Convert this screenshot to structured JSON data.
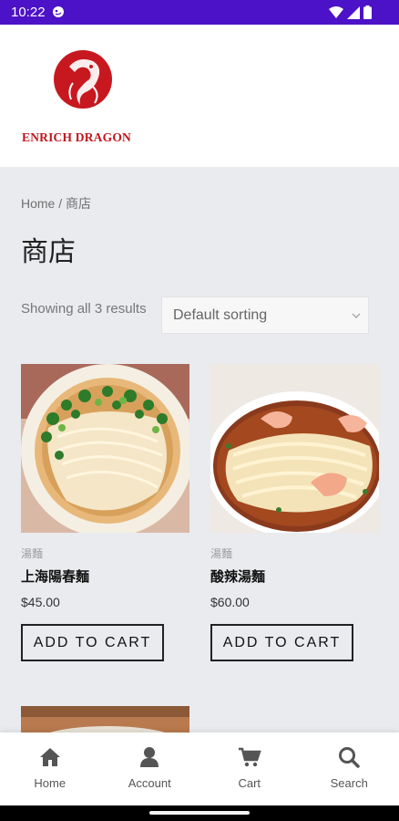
{
  "status_bar": {
    "time": "10:22",
    "app_icon": "notification-app-icon",
    "icons": [
      "wifi-icon",
      "signal-icon",
      "battery-icon"
    ],
    "background": "#4c12c7"
  },
  "header": {
    "logo_text": "ENRICH DRAGON",
    "logo_color": "#c0161c"
  },
  "breadcrumb": {
    "home": "Home",
    "separator": "/",
    "current": "商店"
  },
  "page_title": "商店",
  "result_count": "Showing all 3 results",
  "sort": {
    "selected": "Default sorting"
  },
  "products": [
    {
      "category": "湯麵",
      "name": "上海陽春麵",
      "price": "$45.00",
      "button": "ADD TO CART"
    },
    {
      "category": "湯麵",
      "name": "酸辣湯麵",
      "price": "$60.00",
      "button": "ADD TO CART"
    }
  ],
  "bottom_nav": [
    {
      "label": "Home",
      "icon": "home-icon"
    },
    {
      "label": "Account",
      "icon": "user-icon"
    },
    {
      "label": "Cart",
      "icon": "cart-icon"
    },
    {
      "label": "Search",
      "icon": "search-icon"
    }
  ]
}
